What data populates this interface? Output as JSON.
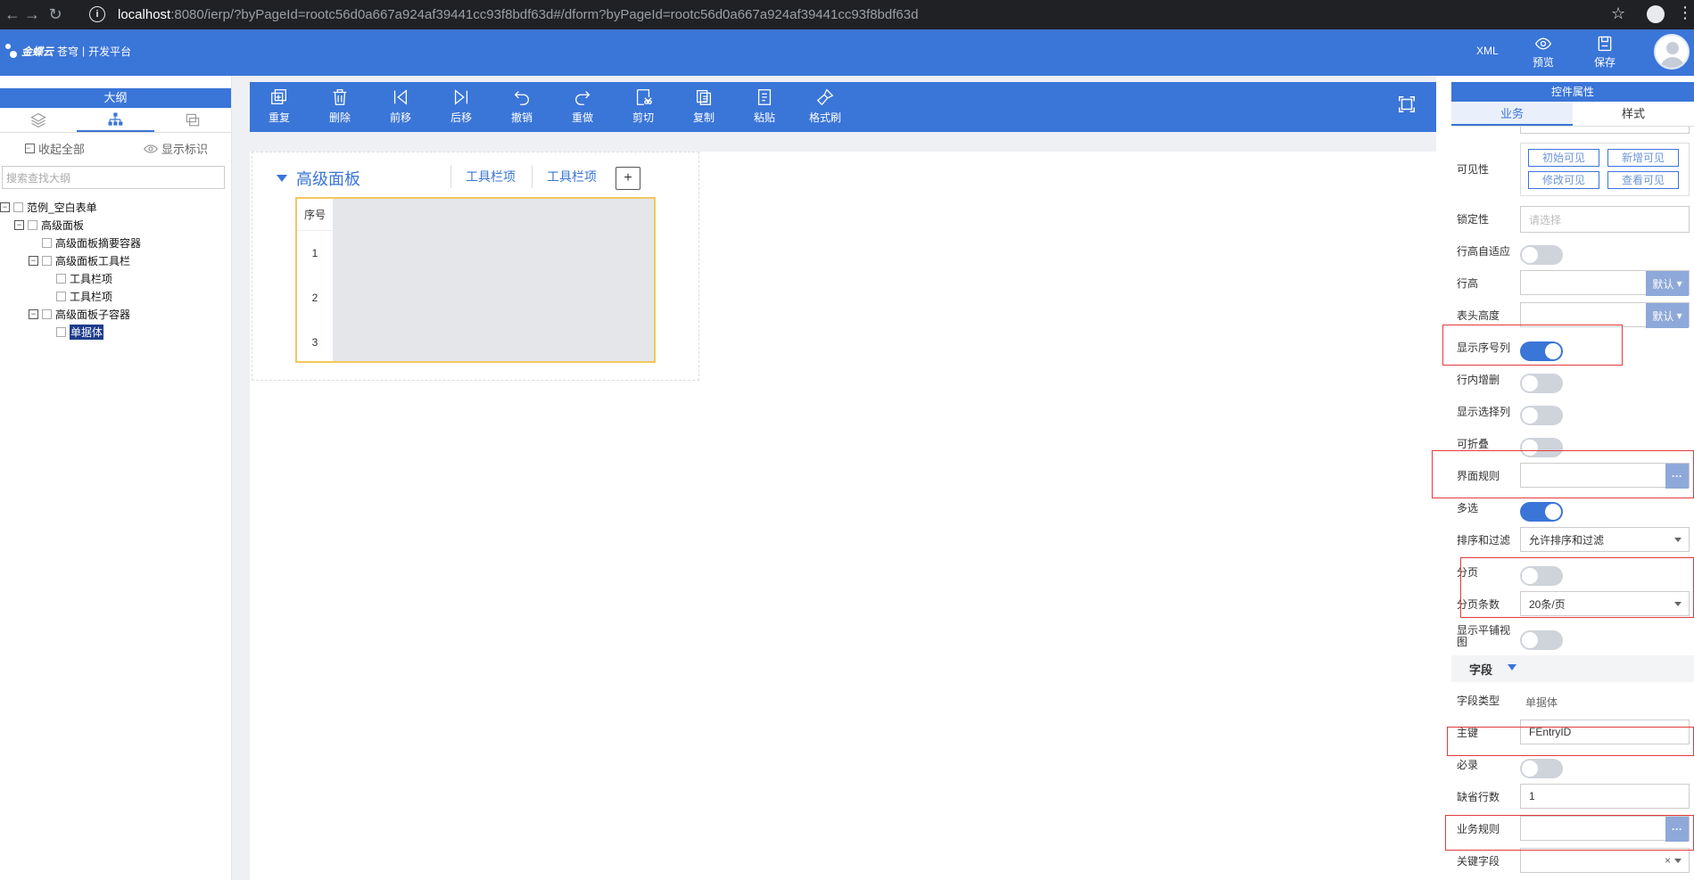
{
  "browser": {
    "url_host": "localhost",
    "url_rest": ":8080/ierp/?byPageId=rootc56d0a667a924af39441cc93f8bdf63d#/dform?byPageId=rootc56d0a667a924af39441cc93f8bdf63d",
    "info_icon": "i"
  },
  "header": {
    "logo_text": "金蝶云 苍穹 | 开发平台",
    "logo_brand": "金蝶云",
    "logo_sub": "苍穹",
    "logo_platform": "开发平台",
    "xml_label": "XML",
    "preview_label": "预览",
    "save_label": "保存"
  },
  "outline": {
    "title": "大纲",
    "collapse_all": "收起全部",
    "show_marks": "显示标识",
    "search_placeholder": "搜索查找大纲",
    "tree": [
      {
        "label": "范例_空白表单",
        "indent": 0,
        "toggle": "−"
      },
      {
        "label": "高级面板",
        "indent": 1,
        "toggle": "−"
      },
      {
        "label": "高级面板摘要容器",
        "indent": 2,
        "toggle": ""
      },
      {
        "label": "高级面板工具栏",
        "indent": 2,
        "toggle": "−"
      },
      {
        "label": "工具栏项",
        "indent": 3,
        "toggle": ""
      },
      {
        "label": "工具栏项",
        "indent": 3,
        "toggle": ""
      },
      {
        "label": "高级面板子容器",
        "indent": 2,
        "toggle": "−"
      },
      {
        "label": "单据体",
        "indent": 3,
        "toggle": "",
        "selected": true
      }
    ]
  },
  "toolbar": {
    "items": [
      "重复",
      "删除",
      "前移",
      "后移",
      "撤销",
      "重做",
      "剪切",
      "复制",
      "粘贴",
      "格式刷"
    ]
  },
  "designer": {
    "panel_title": "高级面板",
    "toolbar_item_1": "工具栏项",
    "toolbar_item_2": "工具栏项",
    "add_label": "+",
    "grid_header": "序号",
    "rows": [
      "1",
      "2",
      "3"
    ]
  },
  "properties": {
    "title": "控件属性",
    "tab_business": "业务",
    "tab_style": "样式",
    "visibility_label": "可见性",
    "vis_initial": "初始可见",
    "vis_new": "新增可见",
    "vis_edit": "修改可见",
    "vis_view": "查看可见",
    "lock_label": "锁定性",
    "lock_placeholder": "请选择",
    "row_auto_label": "行高自适应",
    "row_height_label": "行高",
    "row_height_default": "默认",
    "header_height_label": "表头高度",
    "header_height_default": "默认",
    "show_seq_label": "显示序号列",
    "inline_add_label": "行内增删",
    "show_select_label": "显示选择列",
    "foldable_label": "可折叠",
    "ui_rule_label": "界面规则",
    "multi_label": "多选",
    "sort_filter_label": "排序和过滤",
    "sort_filter_value": "允许排序和过滤",
    "paging_label": "分页",
    "page_size_label": "分页条数",
    "page_size_value": "20条/页",
    "tile_view_label": "显示平铺视图",
    "field_section": "字段",
    "field_type_label": "字段类型",
    "field_type_value": "单据体",
    "pk_label": "主键",
    "pk_value": "FEntryID",
    "required_label": "必录",
    "default_rows_label": "缺省行数",
    "default_rows_value": "1",
    "biz_rule_label": "业务规则",
    "key_field_label": "关键字段",
    "more_label": "···",
    "clear_label": "×"
  },
  "colors": {
    "accent": "#3a75d8",
    "highlight": "#e4393c",
    "grid_border": "#f3c65e"
  },
  "switches": {
    "row_auto": false,
    "show_seq": true,
    "inline_add": false,
    "show_select": false,
    "foldable": false,
    "multi": true,
    "paging": false,
    "tile_view": false,
    "required": false
  }
}
